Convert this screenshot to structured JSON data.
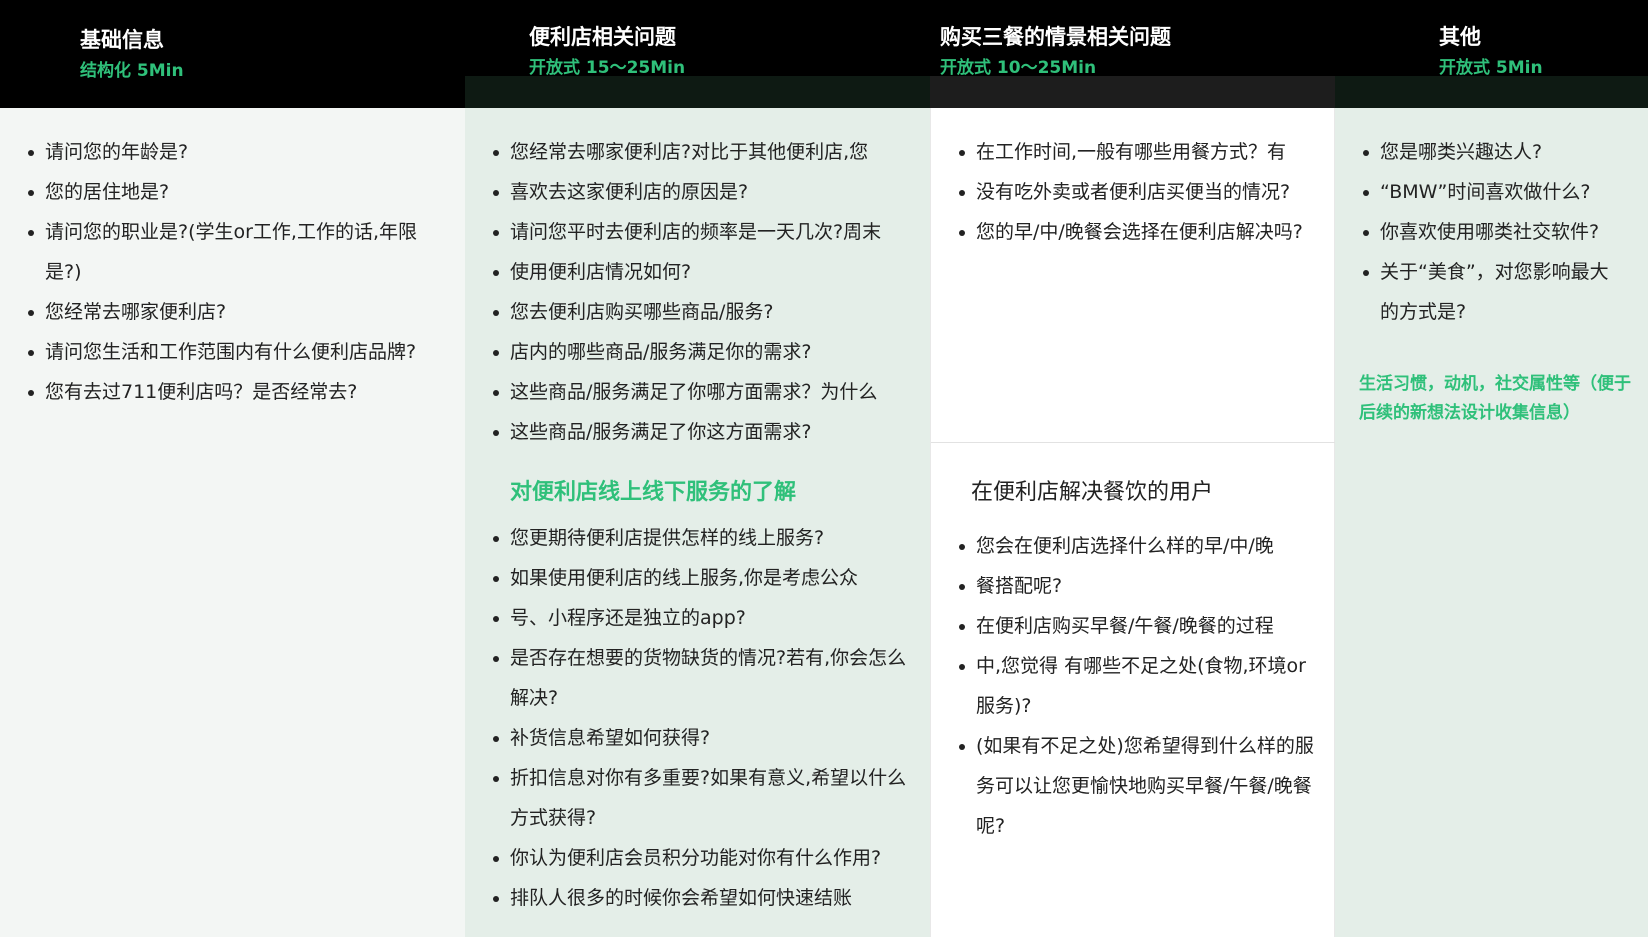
{
  "columns": [
    {
      "title": "基础信息",
      "subtitle": "结构化 5Min",
      "questions": [
        "请问您的年龄是?",
        "您的居住地是?",
        "请问您的职业是?(学生or工作,工作的话,年限是?)",
        "您经常去哪家便利店?",
        "请问您生活和工作范围内有什么便利店品牌?",
        "您有去过711便利店吗？是否经常去?"
      ]
    },
    {
      "title": "便利店相关问题",
      "subtitle": "开放式 15～25Min",
      "questions": [
        "您经常去哪家便利店?对比于其他便利店,您",
        "喜欢去这家便利店的原因是?",
        "请问您平时去便利店的频率是一天几次?周末",
        "使用便利店情况如何?",
        "您去便利店购买哪些商品/服务?",
        "店内的哪些商品/服务满足你的需求?",
        "这些商品/服务满足了你哪方面需求？为什么",
        "这些商品/服务满足了你这方面需求?"
      ],
      "section_title": "对便利店线上线下服务的了解",
      "section_questions": [
        "您更期待便利店提供怎样的线上服务?",
        "如果使用便利店的线上服务,你是考虑公众",
        "号、小程序还是独立的app?",
        "是否存在想要的货物缺货的情况?若有,你会怎么解决?",
        "补货信息希望如何获得?",
        "折扣信息对你有多重要?如果有意义,希望以什么方式获得?",
        "你认为便利店会员积分功能对你有什么作用?",
        "排队人很多的时候你会希望如何快速结账"
      ]
    },
    {
      "title": "购买三餐的情景相关问题",
      "subtitle": "开放式 10～25Min",
      "questions": [
        "在工作时间,一般有哪些用餐方式？有",
        "没有吃外卖或者便利店买便当的情况?",
        "您的早/中/晚餐会选择在便利店解决吗?"
      ],
      "section_title": "在便利店解决餐饮的用户",
      "section_questions": [
        "您会在便利店选择什么样的早/中/晚",
        "餐搭配呢?",
        "在便利店购买早餐/午餐/晚餐的过程",
        "中,您觉得 有哪些不足之处(食物,环境or服务)?",
        "(如果有不足之处)您希望得到什么样的服务可以让您更愉快地购买早餐/午餐/晚餐呢?"
      ]
    },
    {
      "title": "其他",
      "subtitle": "开放式 5Min",
      "questions": [
        "您是哪类兴趣达人?",
        "“BMW”时间喜欢做什么?",
        "你喜欢使用哪类社交软件?",
        "关于“美食”，对您影响最大的方式是?"
      ],
      "note": "生活习惯，动机，社交属性等（便于后续的新想法设计收集信息）"
    }
  ],
  "colors": {
    "accent_green": "#2fc07a",
    "header_bg": "#000000",
    "col1_bg": "#f3f6f4",
    "col2_bg": "#e4eee8",
    "col3_bg": "#ffffff",
    "col4_bg": "#e4eee8"
  }
}
